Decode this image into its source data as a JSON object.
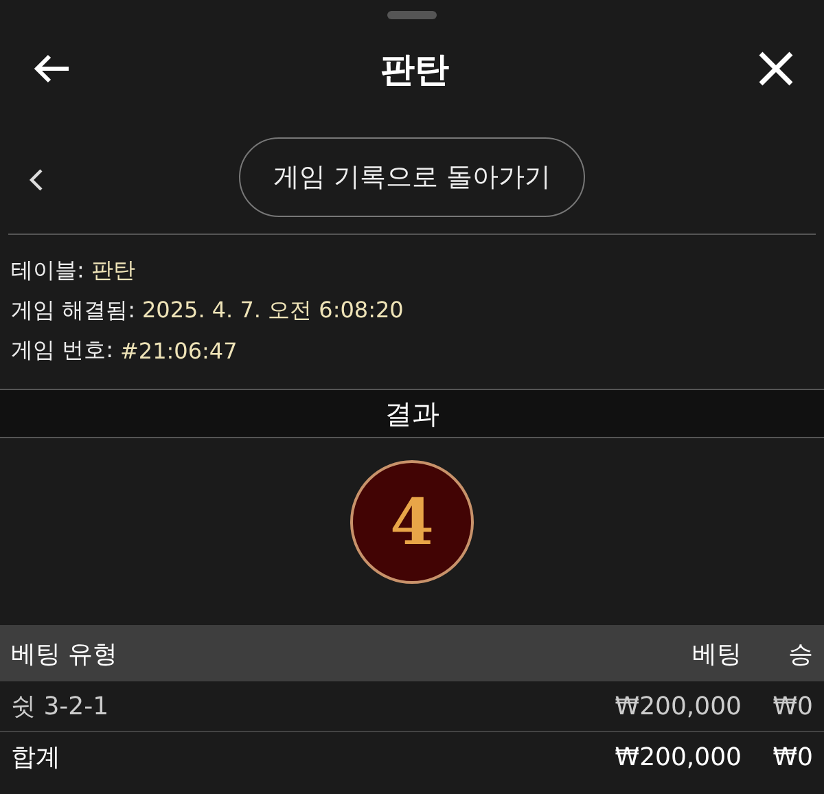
{
  "header": {
    "title": "판탄"
  },
  "back_button": {
    "label": "게임 기록으로 돌아가기"
  },
  "info": [
    {
      "label": "테이블:",
      "value": "판탄"
    },
    {
      "label": "게임 해결됨:",
      "value": "2025. 4. 7. 오전 6:08:20"
    },
    {
      "label": "게임 번호:",
      "value": "#21:06:47"
    }
  ],
  "result": {
    "title": "결과",
    "number": "4"
  },
  "table": {
    "columns": [
      "베팅 유형",
      "베팅",
      "승"
    ],
    "rows": [
      {
        "kind": "bet",
        "cells": [
          "쉿 3-2-1",
          "₩200,000",
          "₩0"
        ]
      },
      {
        "kind": "total",
        "cells": [
          "합계",
          "₩200,000",
          "₩0"
        ]
      }
    ]
  }
}
